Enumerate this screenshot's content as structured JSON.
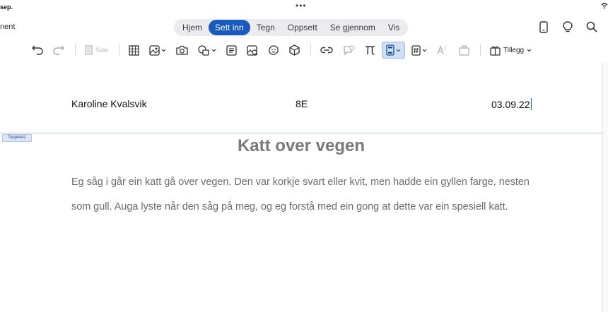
{
  "status_bar": {
    "date_fragment": "sep.",
    "dots": "•••"
  },
  "doc_name_fragment": "nent",
  "tabs": [
    {
      "label": "Hjem",
      "active": false
    },
    {
      "label": "Sett inn",
      "active": true
    },
    {
      "label": "Tegn",
      "active": false
    },
    {
      "label": "Oppsett",
      "active": false
    },
    {
      "label": "Se gjennom",
      "active": false
    },
    {
      "label": "Vis",
      "active": false
    }
  ],
  "top_icons": [
    "phone-icon",
    "lightbulb-icon",
    "search-icon"
  ],
  "ribbon": {
    "page_label": "Side",
    "addins_label": "Tillegg",
    "items": [
      "undo-icon",
      "redo-icon",
      "page-icon",
      "table-icon",
      "picture-icon",
      "camera-icon",
      "shapes-icon",
      "textbox-icon",
      "online-picture-icon",
      "sticker-icon",
      "3d-model-icon",
      "link-icon",
      "comment-icon",
      "equation-icon",
      "header-footer-icon",
      "page-number-icon",
      "superscript-icon",
      "symbol-icon",
      "addins-icon"
    ]
  },
  "header": {
    "left": "Karoline Kvalsvik",
    "middle": "8E",
    "right": "03.09.22",
    "tag": "Topptekst"
  },
  "document": {
    "title": "Katt over vegen",
    "body": "Eg såg i går ein katt gå over vegen. Den var korkje svart eller kvit, men hadde ein gyllen farge, nesten som gull. Auga lyste når den såg på meg, og eg forstå med ein gong at dette var ein spesiell katt."
  },
  "colors": {
    "accent": "#185abd",
    "title": "#7a7a7a",
    "body": "#6b6b6b"
  }
}
